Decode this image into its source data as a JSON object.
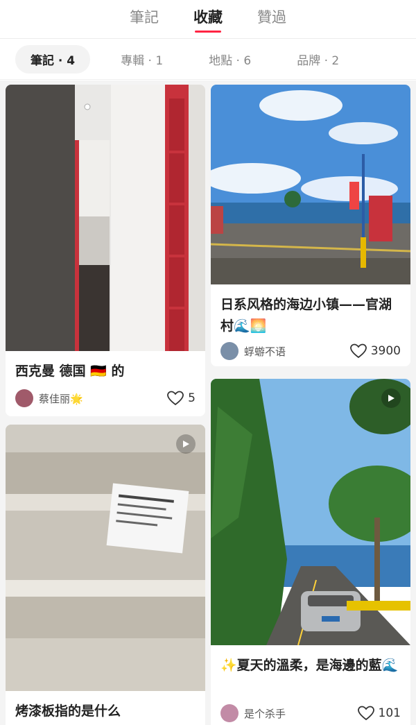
{
  "tabs": [
    {
      "label": "筆記",
      "active": false
    },
    {
      "label": "收藏",
      "active": true
    },
    {
      "label": "贊過",
      "active": false
    }
  ],
  "subtabs": [
    {
      "label": "筆記 · 4",
      "active": true
    },
    {
      "label": "專輯 · 1",
      "active": false
    },
    {
      "label": "地點 · 6",
      "active": false
    },
    {
      "label": "品牌 · 2",
      "active": false
    }
  ],
  "cards": [
    {
      "title": "西克曼 德国 🇩🇪 的",
      "author": "蔡佳丽",
      "author_badge": "🌟",
      "likes": "5",
      "video": false
    },
    {
      "title": "日系风格的海边小镇——官湖村🌊🌅",
      "author": "蜉蝣不语",
      "likes": "3900",
      "video": false
    },
    {
      "title": "烤漆板指的是什么",
      "author": "",
      "likes": "",
      "video": true
    },
    {
      "title": "✨夏天的溫柔，是海邊的藍🌊",
      "author": "是个杀手",
      "likes": "101",
      "video": true
    }
  ],
  "colors": {
    "accent": "#ff2442",
    "cabinet_red": "#c8323c",
    "sky": "#4a8fd8",
    "sea": "#2f6fa8"
  },
  "icons": {
    "like": "heart-outline-icon",
    "video": "play-icon"
  }
}
